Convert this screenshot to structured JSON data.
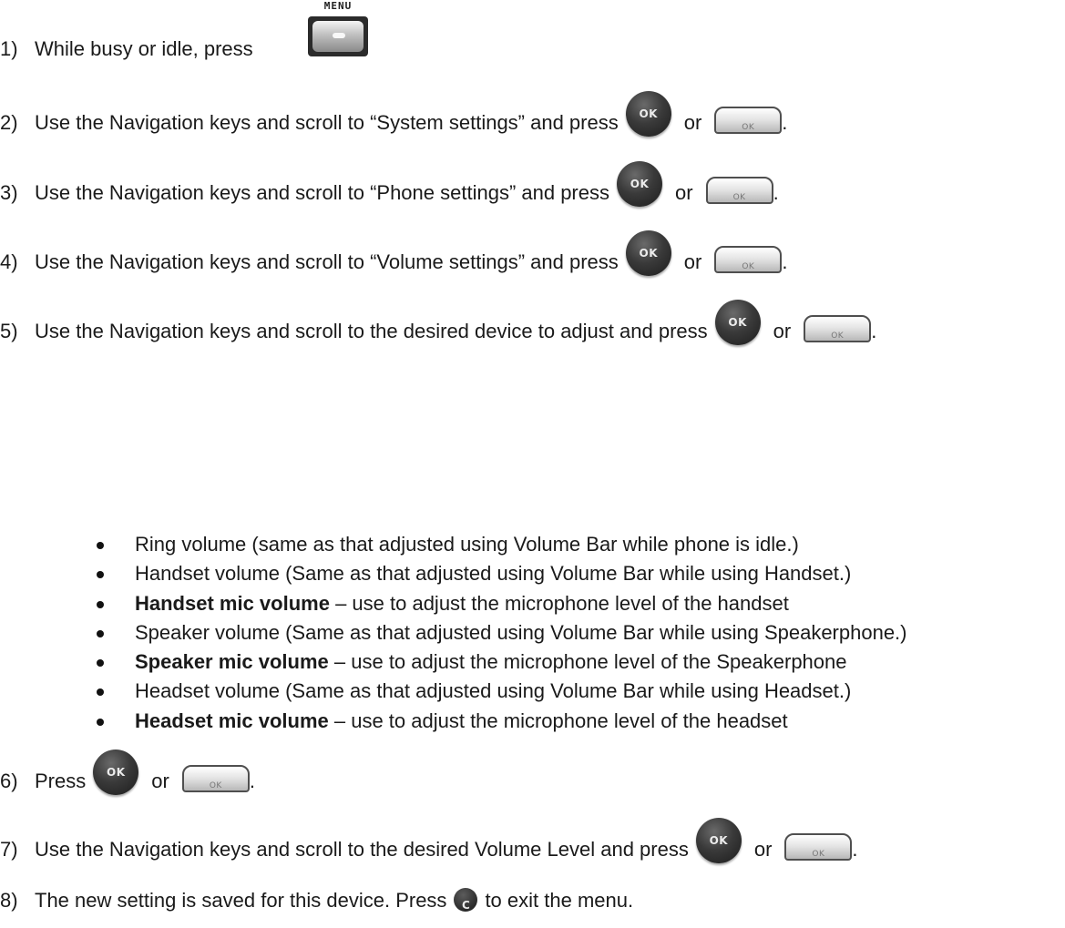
{
  "steps": [
    {
      "num": "1)",
      "text": "While busy or idle, press"
    },
    {
      "num": "2)",
      "text": "Use the Navigation keys and scroll to “System settings” and press",
      "or": "or",
      "end": "."
    },
    {
      "num": "3)",
      "text": "Use the Navigation keys and scroll to “Phone settings” and press",
      "or": "or",
      "end": "."
    },
    {
      "num": "4)",
      "text": "Use the Navigation keys and scroll to “Volume settings” and press",
      "or": "or",
      "end": "."
    },
    {
      "num": "5)",
      "text": "Use the Navigation keys and scroll to the desired device to adjust and press",
      "or": "or",
      "end": "."
    },
    {
      "num": "6)",
      "text": "Press",
      "or": "or",
      "end": "."
    },
    {
      "num": "7)",
      "text": "Use the Navigation keys and scroll to the desired Volume Level and press",
      "or": "or",
      "end": "."
    },
    {
      "num": "8)",
      "text": "The new setting is saved for this device. Press",
      "after": "to exit the menu."
    }
  ],
  "bullets": [
    {
      "bold": "",
      "text": "Ring volume (same as that adjusted using Volume Bar while phone is idle.)"
    },
    {
      "bold": "",
      "text": "Handset volume (Same as that adjusted using Volume Bar while using Handset.)"
    },
    {
      "bold": "Handset mic volume",
      "text": " – use to adjust the microphone level of the handset"
    },
    {
      "bold": "",
      "text": "Speaker volume (Same as that adjusted using Volume Bar while using Speakerphone.)"
    },
    {
      "bold": "Speaker mic volume",
      "text": " – use to adjust the microphone level of the Speakerphone"
    },
    {
      "bold": "",
      "text": "Headset volume (Same as that adjusted using Volume Bar while using Headset.)"
    },
    {
      "bold": "Headset mic volume",
      "text": " – use to adjust the microphone level of the headset"
    }
  ],
  "keys": {
    "menu_label": "MENU",
    "ok_round_label": "OK",
    "ok_soft_label": "OK",
    "c_label": "C"
  },
  "icons": {
    "menu_key": "menu-key-icon",
    "ok_round": "ok-round-key-icon",
    "ok_soft": "ok-softkey-icon",
    "c_key": "c-clear-key-icon"
  }
}
